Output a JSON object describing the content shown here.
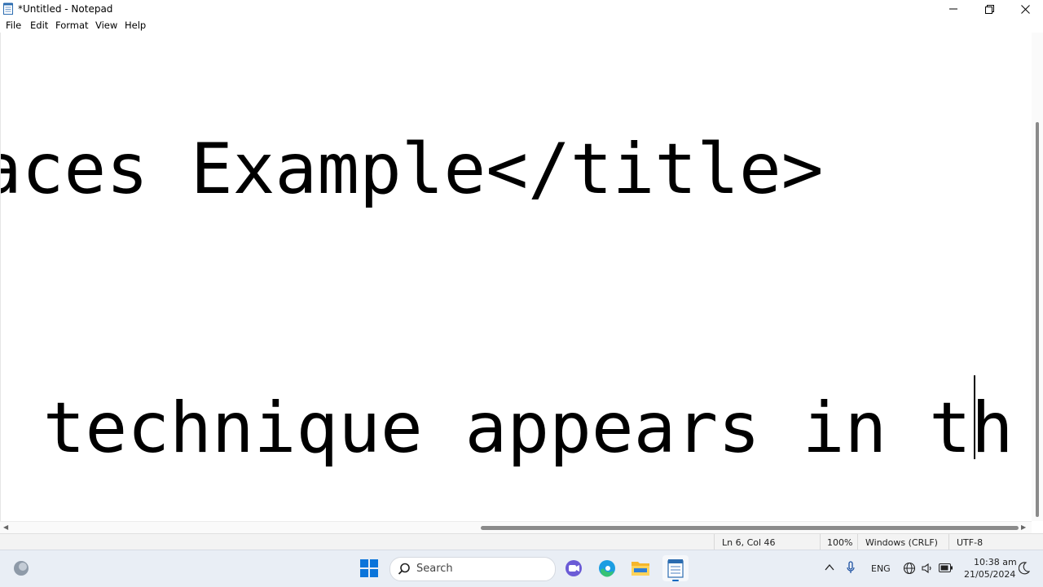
{
  "window": {
    "title": "*Untitled - Notepad"
  },
  "menu": [
    "File",
    "Edit",
    "Format",
    "View",
    "Help"
  ],
  "editor": {
    "lines": [
      "aces Example</title>",
      " technique appears in th"
    ]
  },
  "status": {
    "position": "Ln 6, Col 46",
    "zoom": "100%",
    "line_ending": "Windows (CRLF)",
    "encoding": "UTF-8"
  },
  "taskbar": {
    "search_label": "Search",
    "language": "ENG",
    "time": "10:38 am",
    "date": "21/05/2024"
  },
  "icons": {
    "app": "notepad-icon",
    "minimize": "minimize-icon",
    "maximize": "restore-icon",
    "close": "close-icon"
  },
  "colors": {
    "taskbar": "#e9eef5",
    "accent": "#0067c0"
  }
}
